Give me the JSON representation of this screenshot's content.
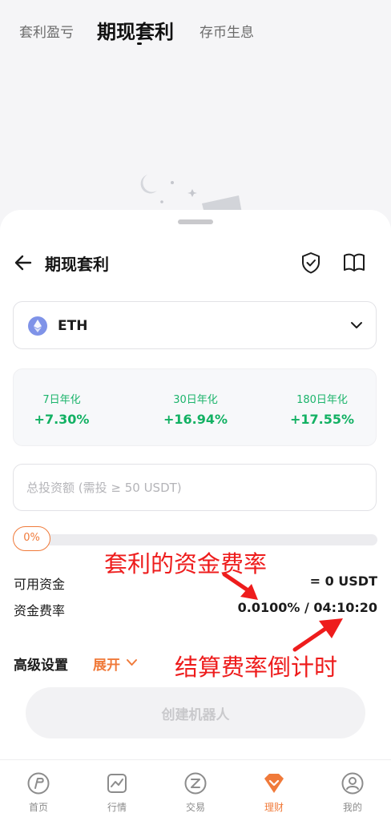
{
  "top_tabs": [
    {
      "label": "套利盈亏"
    },
    {
      "label": "期现套利"
    },
    {
      "label": "存币生息"
    }
  ],
  "header": {
    "title": "期现套利"
  },
  "coin_select": {
    "value": "ETH"
  },
  "rates": [
    {
      "label": "7日年化",
      "value": "+7.30%"
    },
    {
      "label": "30日年化",
      "value": "+16.94%"
    },
    {
      "label": "180日年化",
      "value": "+17.55%"
    }
  ],
  "investment": {
    "placeholder": "总投资额 (需投 ≥ 50 USDT)",
    "value": ""
  },
  "slider": {
    "label": "0%",
    "percent": 0
  },
  "available": {
    "label": "可用资金",
    "value": "= 0 USDT"
  },
  "funding": {
    "label": "资金费率",
    "value": "0.0100% / 04:10:20"
  },
  "annotations": {
    "funding_rate": "套利的资金费率",
    "countdown": "结算费率倒计时",
    "color": "#ee1c1c"
  },
  "advanced": {
    "label": "高级设置",
    "toggle": "展开"
  },
  "create_button": {
    "label": "创建机器人"
  },
  "nav": [
    {
      "label": "首页",
      "icon": "home-icon"
    },
    {
      "label": "行情",
      "icon": "market-icon"
    },
    {
      "label": "交易",
      "icon": "trade-icon"
    },
    {
      "label": "理财",
      "icon": "finance-icon",
      "active": true
    },
    {
      "label": "我的",
      "icon": "profile-icon"
    }
  ],
  "colors": {
    "accent": "#f07a3a",
    "positive": "#12b163"
  }
}
